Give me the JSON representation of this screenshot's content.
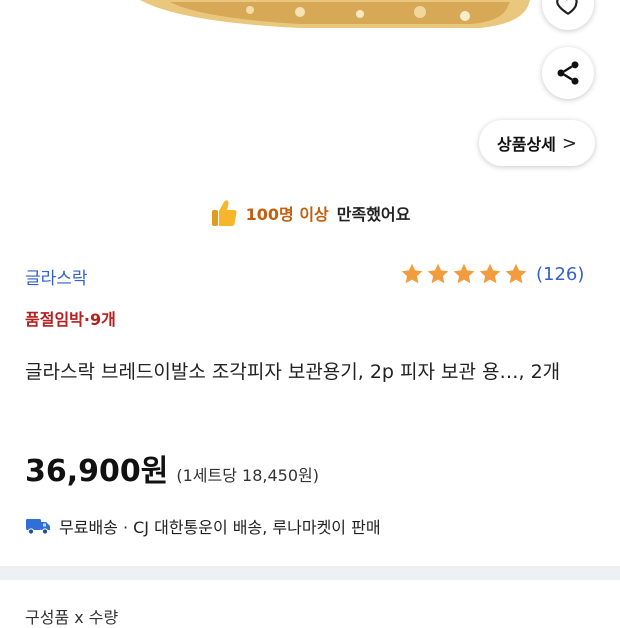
{
  "actions": {
    "heart_icon": "heart-icon",
    "share_icon": "share-icon",
    "detail_label": "상품상세",
    "detail_chevron": ">"
  },
  "satisfaction": {
    "icon": "thumbs-up-icon",
    "highlight": "100명 이상",
    "rest": "만족했어요"
  },
  "product": {
    "brand": "글라스락",
    "rating": {
      "stars": 5,
      "count": "(126)"
    },
    "stock_notice": "품절임박·9개",
    "title": "글라스락 브레드이발소 조각피자 보관용기, 2p 피자 보관 용…, 2개",
    "price": "36,900원",
    "unit_price": "(1세트당 18,450원)"
  },
  "delivery": {
    "icon": "truck-icon",
    "text": "무료배송 · CJ 대한통운이 배송, 루나마켓이 판매"
  },
  "option": {
    "label": "구성품 x 수량"
  },
  "colors": {
    "brand_blue": "#3462c8",
    "star": "#f39c3d",
    "stock_red": "#b3201f",
    "highlight_orange": "#c2600f",
    "thumb_yellow": "#f7b52b"
  }
}
